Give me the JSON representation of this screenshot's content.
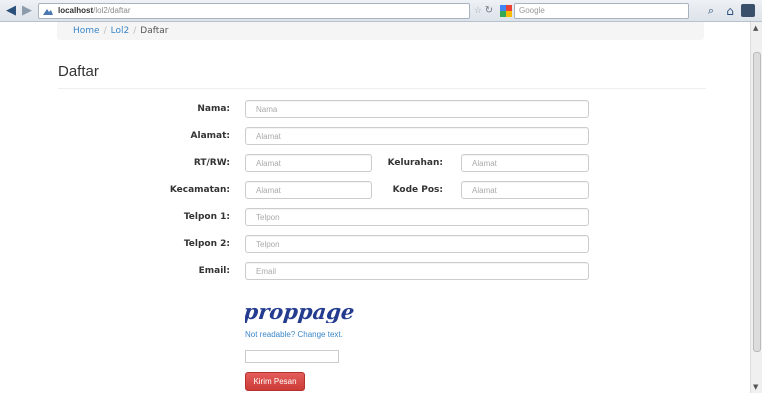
{
  "browser": {
    "url_host": "localhost",
    "url_path": "/lol2/daftar",
    "search_placeholder": "Google",
    "back_glyph": "◀",
    "forward_glyph": "▶",
    "icons": [
      "back-arrow-icon",
      "forward-arrow-icon",
      "site-favicon-icon",
      "star-icon",
      "reload-icon",
      "google-icon",
      "search-icon",
      "home-icon",
      "menu-icon"
    ]
  },
  "breadcrumb": {
    "home": "Home",
    "sep1": "/",
    "section": "Lol2",
    "sep2": "/",
    "current": "Daftar"
  },
  "page": {
    "title": "Daftar"
  },
  "form": {
    "nama": {
      "label": "Nama:",
      "placeholder": "Nama"
    },
    "alamat": {
      "label": "Alamat:",
      "placeholder": "Alamat"
    },
    "rtrw": {
      "label": "RT/RW:",
      "placeholder": "Alamat"
    },
    "kelurahan": {
      "label": "Kelurahan:",
      "placeholder": "Alamat"
    },
    "kecamatan": {
      "label": "Kecamatan:",
      "placeholder": "Alamat"
    },
    "kodepos": {
      "label": "Kode Pos:",
      "placeholder": "Alamat"
    },
    "telpon1": {
      "label": "Telpon 1:",
      "placeholder": "Telpon"
    },
    "telpon2": {
      "label": "Telpon 2:",
      "placeholder": "Telpon"
    },
    "email": {
      "label": "Email:",
      "placeholder": "Email"
    },
    "captcha_word": "proppage",
    "captcha_link": "Not readable? Change text.",
    "submit": "Kirim Pesan"
  },
  "colors": {
    "link": "#3a87c8",
    "button": "#d9534f",
    "captcha": "#233c8f"
  }
}
